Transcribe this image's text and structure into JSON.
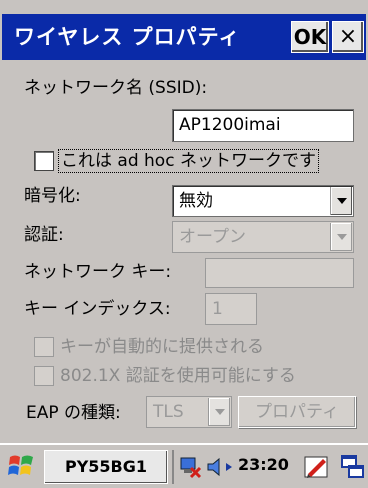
{
  "window": {
    "title": "ワイヤレス プロパティ",
    "ok_label": "OK",
    "close_label": "×"
  },
  "form": {
    "ssid_label": "ネットワーク名 (SSID):",
    "ssid_value": "AP1200imai",
    "adhoc_label": "これは ad hoc ネットワークです",
    "adhoc_checked": false,
    "encryption_label": "暗号化:",
    "encryption_value": "無効",
    "auth_label": "認証:",
    "auth_value": "オープン",
    "network_key_label": "ネットワーク キー:",
    "network_key_value": "",
    "key_index_label": "キー インデックス:",
    "key_index_value": "1",
    "auto_key_label": "キーが自動的に提供される",
    "auto_key_checked": false,
    "dot1x_label": "802.1X 認証を使用可能にする",
    "dot1x_checked": false,
    "eap_label": "EAP の種類:",
    "eap_value": "TLS",
    "properties_label": "プロパティ"
  },
  "taskbar": {
    "task_label": "PY55BG1",
    "clock": "23:20"
  },
  "icons": {
    "start": "windows-flag-icon",
    "network": "network-status-icon",
    "volume": "speaker-arrow-icon",
    "pen": "pen-input-icon",
    "window": "window-switch-icon"
  }
}
